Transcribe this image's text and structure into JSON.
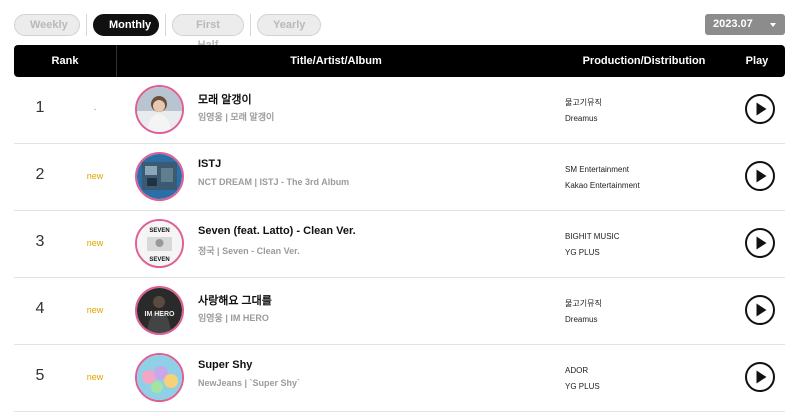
{
  "tabs": [
    {
      "label": "Weekly",
      "active": false
    },
    {
      "label": "Monthly",
      "active": true
    },
    {
      "label": "First Half",
      "active": false
    },
    {
      "label": "Yearly",
      "active": false
    }
  ],
  "date_select": {
    "value": "2023.07",
    "icon": "chevron-down-icon"
  },
  "table_header": {
    "rank": "Rank",
    "title": "Title/Artist/Album",
    "production": "Production/Distribution",
    "play": "Play"
  },
  "rows": [
    {
      "rank": "1",
      "change": "-",
      "title": "모래 알갱이",
      "artist_album": "임영웅 | 모래 알갱이",
      "production": "물고기뮤직",
      "distribution": "Dreamus"
    },
    {
      "rank": "2",
      "change": "new",
      "title": "ISTJ",
      "artist_album": "NCT DREAM | ISTJ - The 3rd Album",
      "production": "SM Entertainment",
      "distribution": "Kakao Entertainment"
    },
    {
      "rank": "3",
      "change": "new",
      "title": "Seven (feat. Latto) - Clean Ver.",
      "artist_album": "정국 | Seven - Clean Ver.",
      "production": "BIGHIT MUSIC",
      "distribution": "YG PLUS"
    },
    {
      "rank": "4",
      "change": "new",
      "title": "사랑해요 그대를",
      "artist_album": "임영웅 | IM HERO",
      "production": "물고기뮤직",
      "distribution": "Dreamus"
    },
    {
      "rank": "5",
      "change": "new",
      "title": "Super Shy",
      "artist_album": "NewJeans | `Super Shy`",
      "production": "ADOR",
      "distribution": "YG PLUS"
    }
  ],
  "cover_art": {
    "row3_text_top": "SEVEN",
    "row3_text_bottom": "SEVEN",
    "row4_text": "IM HERO"
  },
  "colors": {
    "accent_new": "#e3a400",
    "cover_ring": "#df5f95",
    "header_bg": "#000000"
  }
}
